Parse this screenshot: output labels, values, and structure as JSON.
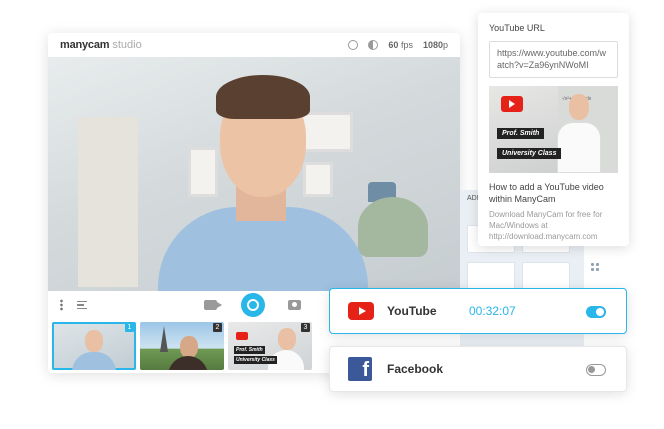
{
  "app": {
    "brand": "manycam",
    "brand_sub": "studio",
    "fps": "60",
    "fps_unit": "fps",
    "resolution": "1080",
    "resolution_unit": "p"
  },
  "thumbnails": [
    {
      "number": "1",
      "active": true
    },
    {
      "number": "2",
      "active": false
    },
    {
      "number": "3",
      "active": false,
      "label_top": "Prof. Smith",
      "label_bottom": "University Class"
    }
  ],
  "side_panel": {
    "label": "ADI"
  },
  "youtube_card": {
    "title": "YouTube URL",
    "url": "https://www.youtube.com/watch?v=Za96ynNWoMI",
    "preview_label_top": "Prof. Smith",
    "preview_label_bottom": "University Class",
    "video_title": "How to add a YouTube video within ManyCam",
    "video_description": "Download ManyCam for free for Mac/Windows at http://download.manycam.com"
  },
  "streams": [
    {
      "name": "YouTube",
      "time": "00:32:07",
      "enabled": true,
      "icon": "youtube-icon"
    },
    {
      "name": "Facebook",
      "time": "",
      "enabled": false,
      "icon": "facebook-icon"
    }
  ],
  "colors": {
    "accent": "#29b6e9",
    "youtube_red": "#e62117",
    "facebook_blue": "#3b5998"
  }
}
